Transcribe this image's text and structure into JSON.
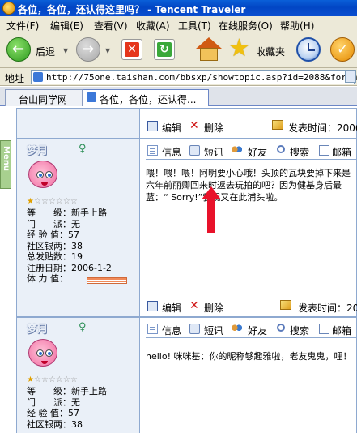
{
  "window": {
    "title": "各位，各位，还认得这里吗？ - Tencent Traveler"
  },
  "menu": [
    "文件(F)",
    "编辑(E)",
    "查看(V)",
    "收藏(A)",
    "工具(T)",
    "在线服务(O)",
    "帮助(H)"
  ],
  "toolbar": {
    "back_label": "后退",
    "favorites_label": "收藏夹"
  },
  "address": {
    "label": "地址",
    "url": "http://75one.taishan.com/bbsxp/showtopic.asp?id=2088&forumid"
  },
  "tabs": [
    {
      "label": "台山同学网"
    },
    {
      "label": "各位，各位，还认得..."
    }
  ],
  "sidebar_tab": "Menu",
  "top_row": {
    "edit": "编辑",
    "delete": "删除",
    "post_time": "发表时间：2006"
  },
  "actions": {
    "info": "信息",
    "sms": "短讯",
    "friend": "好友",
    "search": "搜索",
    "mail": "邮箱"
  },
  "posts": [
    {
      "username": "梦月",
      "gender_symbol": "♀",
      "stars_on": 1,
      "stars_total": 7,
      "stats": [
        {
          "label": "等　　级：",
          "value": "新手上路"
        },
        {
          "label": "门　　派：",
          "value": "无"
        },
        {
          "label": "经 验 值：",
          "value": "57"
        },
        {
          "label": "社区银两：",
          "value": "38"
        },
        {
          "label": "总发贴数：",
          "value": "19"
        },
        {
          "label": "注册日期：",
          "value": "2006-1-2"
        },
        {
          "label": "体 力 值：",
          "value": ""
        }
      ],
      "body": "喂！喂！喂！阿明要小心哦！头顶的瓦块要掉下来是六年前丽卿回来时返去玩拍的吧？因为健基身后最蓝：“ Sorry!”我现又在此浦头啦。",
      "edit": "编辑",
      "delete": "删除",
      "post_time": "发表时间：200"
    },
    {
      "username": "梦月",
      "gender_symbol": "♀",
      "stars_on": 1,
      "stars_total": 7,
      "stats": [
        {
          "label": "等　　级：",
          "value": "新手上路"
        },
        {
          "label": "门　　派：",
          "value": "无"
        },
        {
          "label": "经 验 值：",
          "value": "57"
        },
        {
          "label": "社区银两：",
          "value": "38"
        }
      ],
      "body": "hello! 咪咪基：你的昵称够趣雅啦，老友鬼鬼，哩！"
    }
  ]
}
